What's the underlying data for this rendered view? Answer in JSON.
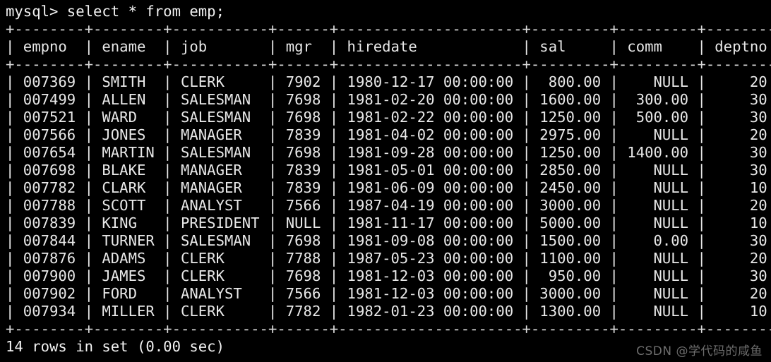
{
  "terminal": {
    "prompt": "mysql> select * from emp;",
    "status_line": "14 rows in set (0.00 sec)",
    "background_color": "#000000",
    "text_color": "#e8e8e8",
    "watermark": "CSDN @学代码的咸鱼",
    "watermark_color": "#6d6d6d"
  },
  "query": {
    "statement": "select * from emp;",
    "table": "emp",
    "row_count": 14,
    "elapsed": "0.00 sec"
  },
  "table": {
    "columns": [
      {
        "name": "empno",
        "width": 8,
        "align": "right"
      },
      {
        "name": "ename",
        "width": 8,
        "align": "left"
      },
      {
        "name": "job",
        "width": 11,
        "align": "left"
      },
      {
        "name": "mgr",
        "width": 6,
        "align": "right"
      },
      {
        "name": "hiredate",
        "width": 21,
        "align": "left"
      },
      {
        "name": "sal",
        "width": 9,
        "align": "right"
      },
      {
        "name": "comm",
        "width": 9,
        "align": "right"
      },
      {
        "name": "deptno",
        "width": 8,
        "align": "right"
      }
    ],
    "rows": [
      [
        "007369",
        "SMITH",
        "CLERK",
        "7902",
        "1980-12-17 00:00:00",
        "800.00",
        "NULL",
        "20"
      ],
      [
        "007499",
        "ALLEN",
        "SALESMAN",
        "7698",
        "1981-02-20 00:00:00",
        "1600.00",
        "300.00",
        "30"
      ],
      [
        "007521",
        "WARD",
        "SALESMAN",
        "7698",
        "1981-02-22 00:00:00",
        "1250.00",
        "500.00",
        "30"
      ],
      [
        "007566",
        "JONES",
        "MANAGER",
        "7839",
        "1981-04-02 00:00:00",
        "2975.00",
        "NULL",
        "20"
      ],
      [
        "007654",
        "MARTIN",
        "SALESMAN",
        "7698",
        "1981-09-28 00:00:00",
        "1250.00",
        "1400.00",
        "30"
      ],
      [
        "007698",
        "BLAKE",
        "MANAGER",
        "7839",
        "1981-05-01 00:00:00",
        "2850.00",
        "NULL",
        "30"
      ],
      [
        "007782",
        "CLARK",
        "MANAGER",
        "7839",
        "1981-06-09 00:00:00",
        "2450.00",
        "NULL",
        "10"
      ],
      [
        "007788",
        "SCOTT",
        "ANALYST",
        "7566",
        "1987-04-19 00:00:00",
        "3000.00",
        "NULL",
        "20"
      ],
      [
        "007839",
        "KING",
        "PRESIDENT",
        "NULL",
        "1981-11-17 00:00:00",
        "5000.00",
        "NULL",
        "10"
      ],
      [
        "007844",
        "TURNER",
        "SALESMAN",
        "7698",
        "1981-09-08 00:00:00",
        "1500.00",
        "0.00",
        "30"
      ],
      [
        "007876",
        "ADAMS",
        "CLERK",
        "7788",
        "1987-05-23 00:00:00",
        "1100.00",
        "NULL",
        "20"
      ],
      [
        "007900",
        "JAMES",
        "CLERK",
        "7698",
        "1981-12-03 00:00:00",
        "950.00",
        "NULL",
        "30"
      ],
      [
        "007902",
        "FORD",
        "ANALYST",
        "7566",
        "1981-12-03 00:00:00",
        "3000.00",
        "NULL",
        "20"
      ],
      [
        "007934",
        "MILLER",
        "CLERK",
        "7782",
        "1982-01-23 00:00:00",
        "1300.00",
        "NULL",
        "10"
      ]
    ]
  }
}
